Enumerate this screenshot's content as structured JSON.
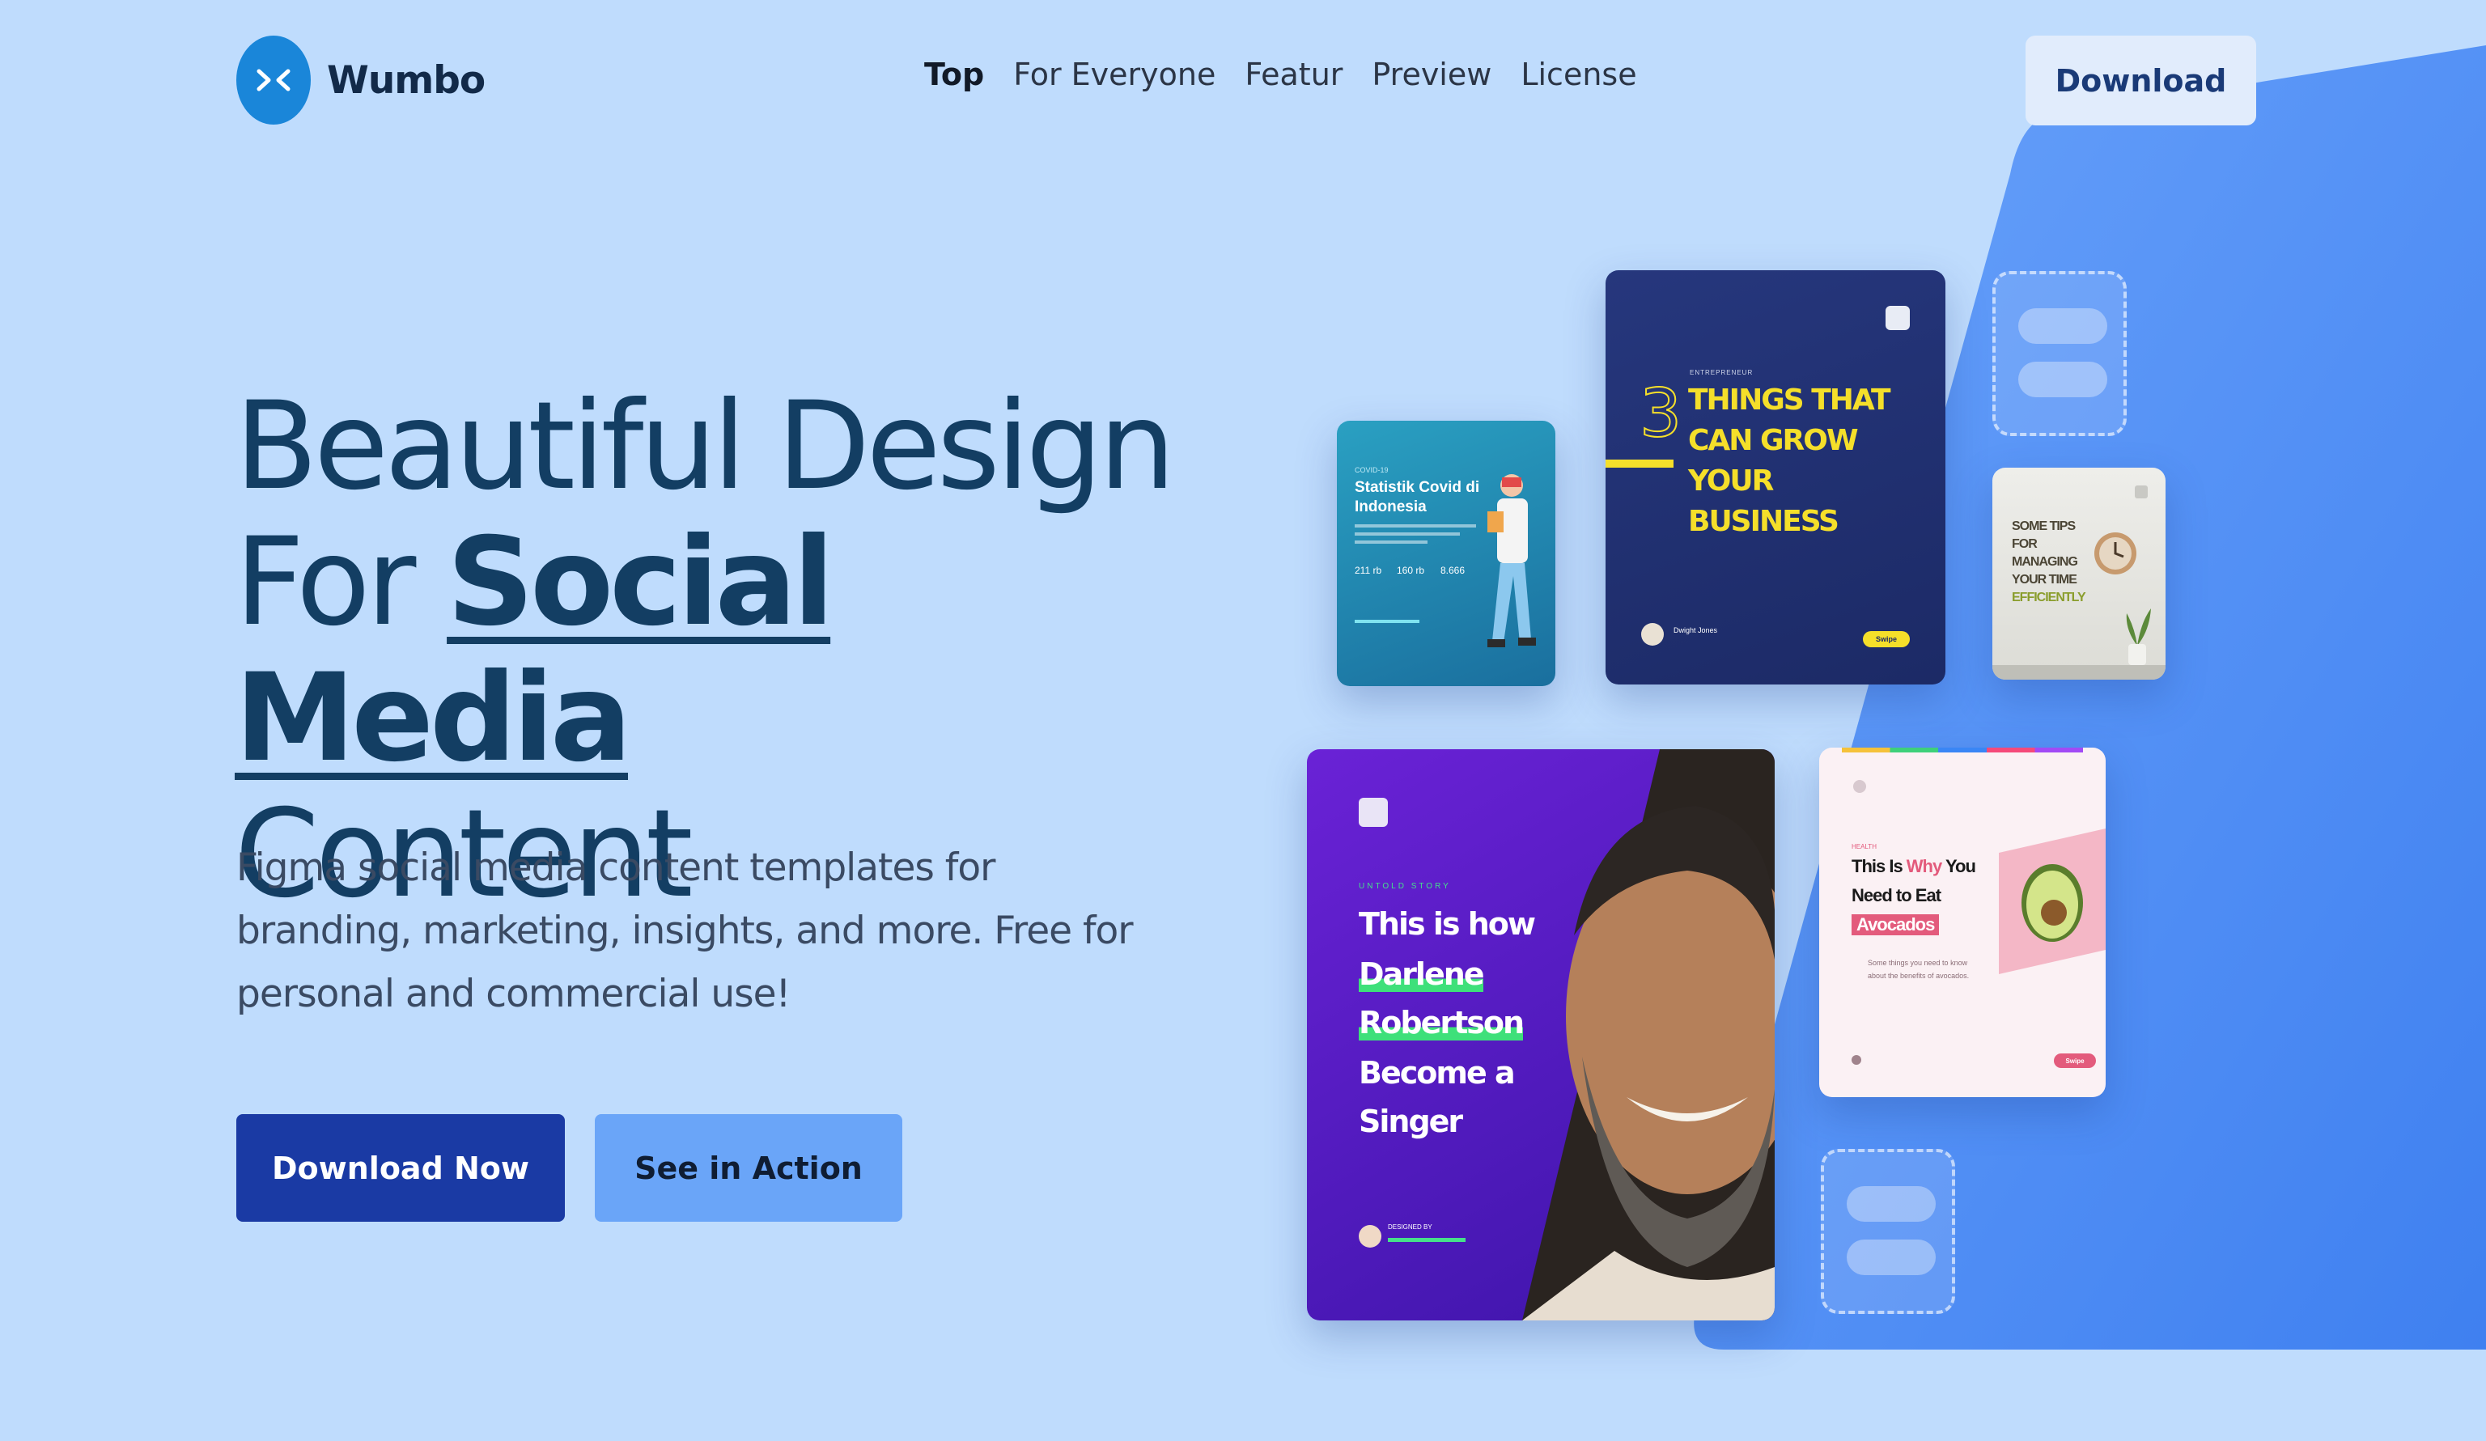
{
  "brand": {
    "name": "Wumbo"
  },
  "nav": {
    "items": [
      {
        "label": "Top",
        "active": true
      },
      {
        "label": "For Everyone",
        "active": false
      },
      {
        "label": "Featur",
        "active": false
      },
      {
        "label": "Preview",
        "active": false
      },
      {
        "label": "License",
        "active": false
      }
    ],
    "download_label": "Download"
  },
  "hero": {
    "title_line1": "Beautiful Design",
    "title_for": "For ",
    "title_accent": "Social Media",
    "title_line3": "Content",
    "subtitle": "Figma social media content templates for branding, marketing, insights, and more. Free for personal and commercial use!",
    "primary_cta": "Download Now",
    "secondary_cta": "See in Action"
  },
  "cards": {
    "covid": {
      "tag": "COVID-19",
      "title_line1": "Statistik Covid di",
      "title_line2": "Indonesia",
      "stats": [
        "211 rb",
        "160 rb",
        "8.666"
      ]
    },
    "business": {
      "tag": "ENTREPRENEUR",
      "number": "3",
      "lines": [
        "THINGS THAT",
        "CAN GROW",
        "YOUR",
        "BUSINESS"
      ],
      "author": "Dwight Jones",
      "button": "Swipe"
    },
    "tips": {
      "lines": [
        "SOME TIPS",
        "FOR",
        "MANAGING",
        "YOUR TIME",
        "EFFICIENTLY"
      ]
    },
    "singer": {
      "tag": "UNTOLD STORY",
      "lines": [
        "This is how",
        "Darlene",
        "Robertson",
        "Become a",
        "Singer"
      ],
      "byline": "DESIGNED BY"
    },
    "avocado": {
      "tag": "HEALTH",
      "line1_pre": "This Is ",
      "line1_accent": "Why",
      "line1_post": " You",
      "line2": "Need to Eat",
      "line3": "Avocados",
      "body": "Some things you need to know about the benefits of avocados.",
      "button": "Swipe"
    }
  },
  "colors": {
    "page_bg": "#bfdcfd",
    "accent_blue": "#4a8cf4",
    "primary_button": "#1a3aa4",
    "secondary_button": "#6aa5f8",
    "title_text": "#133e63"
  }
}
